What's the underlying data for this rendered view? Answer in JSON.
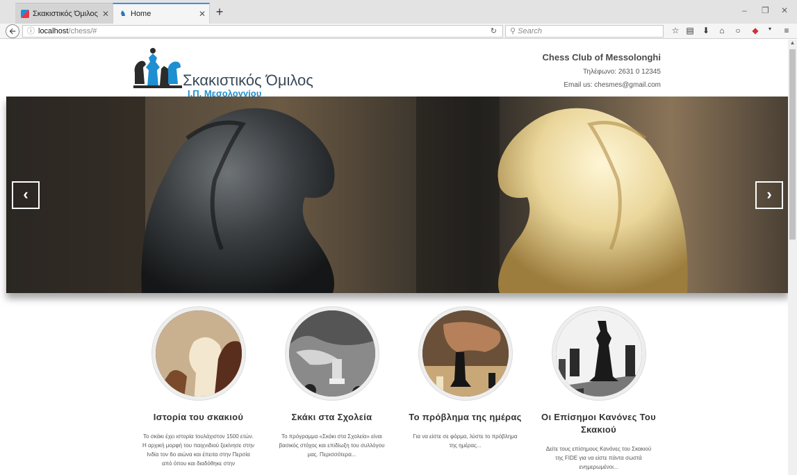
{
  "browser": {
    "tabs": [
      {
        "label": "Σκακιστικός Όμιλος Ι.Π. ...",
        "close": "✕"
      },
      {
        "label": "Home",
        "close": "✕"
      }
    ],
    "new_tab": "+",
    "url": {
      "host": "localhost",
      "path": "/chess/#"
    },
    "search_placeholder": "Search",
    "window_controls": [
      "–",
      "❐",
      "✕"
    ],
    "toolbar_icons": [
      "star-icon",
      "reader-icon",
      "download-icon",
      "home-icon",
      "chat-icon",
      "addon-icon",
      "menu-icon"
    ]
  },
  "header": {
    "logo_title": "Σκακιστικός Όμιλος",
    "logo_subtitle": "Ι.Π. Μεσολογγίου",
    "contact_name": "Chess Club of Messolonghi",
    "phone": "Τηλέφωνο: 2631 0 12345",
    "email": "Email us: chesmes@gmail.com"
  },
  "slider": {
    "prev": "‹",
    "next": "›"
  },
  "features": [
    {
      "title": "Ιστορία του σκακιού",
      "text": "Το σκάκι έχει ιστορία τουλάχιστον 1500 ετών. Η αρχική μορφή του παιχνιδιού ξεκίνησε στην Ινδία τον 6ο αιώνα και έπειτα στην Περσία από όπου και διαδόθηκε στην"
    },
    {
      "title": "Σκάκι στα Σχολεία",
      "text": "Το πρόγραμμα «Σκάκι στα Σχολεία» είναι βασικός στόχος και επιδίωξη του συλλόγου μας. Περισσότερα..."
    },
    {
      "title": "Το πρόβλημα της ημέρας",
      "text": "Για να είστε σε φόρμα, λύστε το πρόβλημα της ημέρας..."
    },
    {
      "title": "Οι Επίσημοι Κανόνες Του Σκακιού",
      "text": "Δείτε τους επίσημους Κανόνες του Σκακιού της FIDE για να είστε πάντα σωστά ενημερωμένοι..."
    }
  ]
}
